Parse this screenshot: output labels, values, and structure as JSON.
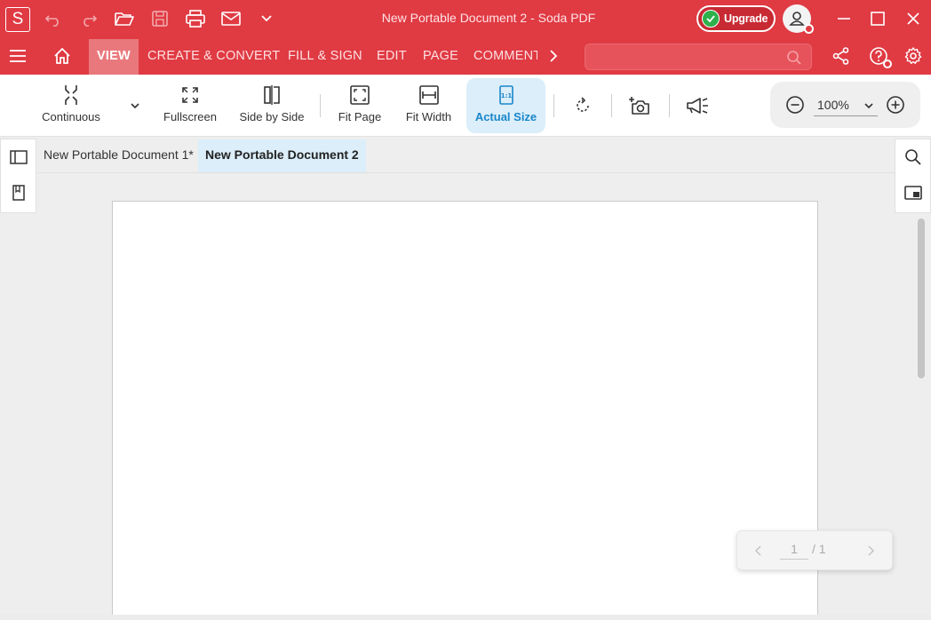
{
  "app": {
    "logo_letter": "S",
    "title": "New Portable Document 2   -   Soda PDF",
    "upgrade_label": "Upgrade",
    "accent_color": "#e03a43"
  },
  "quick_access": [
    "undo-icon",
    "redo-icon",
    "open-folder-icon",
    "save-icon",
    "print-icon",
    "email-icon",
    "chevron-down-icon"
  ],
  "ribbon_tabs": [
    {
      "label": "VIEW",
      "active": true
    },
    {
      "label": "CREATE & CONVERT"
    },
    {
      "label": "FILL & SIGN"
    },
    {
      "label": "EDIT"
    },
    {
      "label": "PAGE"
    },
    {
      "label": "COMMENT"
    }
  ],
  "search": {
    "placeholder": ""
  },
  "toolbar": {
    "continuous": "Continuous",
    "fullscreen": "Fullscreen",
    "side_by_side": "Side by Side",
    "fit_page": "Fit Page",
    "fit_width": "Fit Width",
    "actual_size": "Actual Size",
    "actual_size_active": true,
    "zoom": "100%"
  },
  "doc_tabs": [
    {
      "label": "New Portable Document 1*",
      "active": false
    },
    {
      "label": "New Portable Document 2",
      "active": true
    }
  ],
  "pager": {
    "current": "1",
    "total": "/ 1"
  }
}
